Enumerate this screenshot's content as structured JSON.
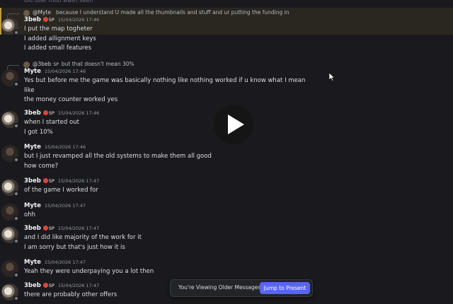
{
  "top_partial_line": "old user mod wash seen",
  "messages": [
    {
      "author": "3beb",
      "badge": "SP",
      "time": "15/04/2026 17:46",
      "reply_to": {
        "author": "@Myte",
        "badge": "",
        "text": "because I understand U made all the thumbnails and stuff and ur putting the funding in"
      },
      "lines": [
        "I put the map togheter",
        "I added allignment keys",
        "I added small features"
      ]
    },
    {
      "author": "Myte",
      "badge": "",
      "time": "15/04/2026 17:46",
      "reply_to": {
        "author": "@3beb",
        "badge": "SP",
        "text": "but that doesn't mean 30%"
      },
      "lines": [
        "Yes but before me the game was basically nothing like nothing worked if u know what I mean",
        "like",
        "the money counter worked yes"
      ]
    },
    {
      "author": "3beb",
      "badge": "SP",
      "time": "15/04/2026 17:46",
      "lines": [
        "when I started out",
        "I got 10%"
      ]
    },
    {
      "author": "Myte",
      "badge": "",
      "time": "15/04/2026 17:46",
      "lines": [
        "but I just revamped all the old systems to make them all good",
        "how come?"
      ]
    },
    {
      "author": "3beb",
      "badge": "SP",
      "time": "15/04/2026 17:47",
      "lines": [
        "of the game I worked for"
      ]
    },
    {
      "author": "Myte",
      "badge": "",
      "time": "15/04/2026 17:47",
      "lines": [
        "ohh"
      ]
    },
    {
      "author": "3beb",
      "badge": "SP",
      "time": "15/04/2026 17:47",
      "lines": [
        "and I did like majority of the work for it",
        "I am sorry but that's just how it is"
      ]
    },
    {
      "author": "Myte",
      "badge": "",
      "time": "15/04/2026 17:47",
      "lines": [
        "Yeah they were underpaying you a lot then"
      ]
    },
    {
      "author": "3beb",
      "badge": "SP",
      "time": "15/04/2026 17:47",
      "lines": [
        "there are probably other offers"
      ]
    }
  ],
  "older_banner": {
    "text": "You're Viewing Older Messages",
    "button": "Jump to Present"
  },
  "colors": {
    "accent": "#5865f2",
    "highlight_bar": "#c59a3c",
    "badge": "#e0453a"
  }
}
